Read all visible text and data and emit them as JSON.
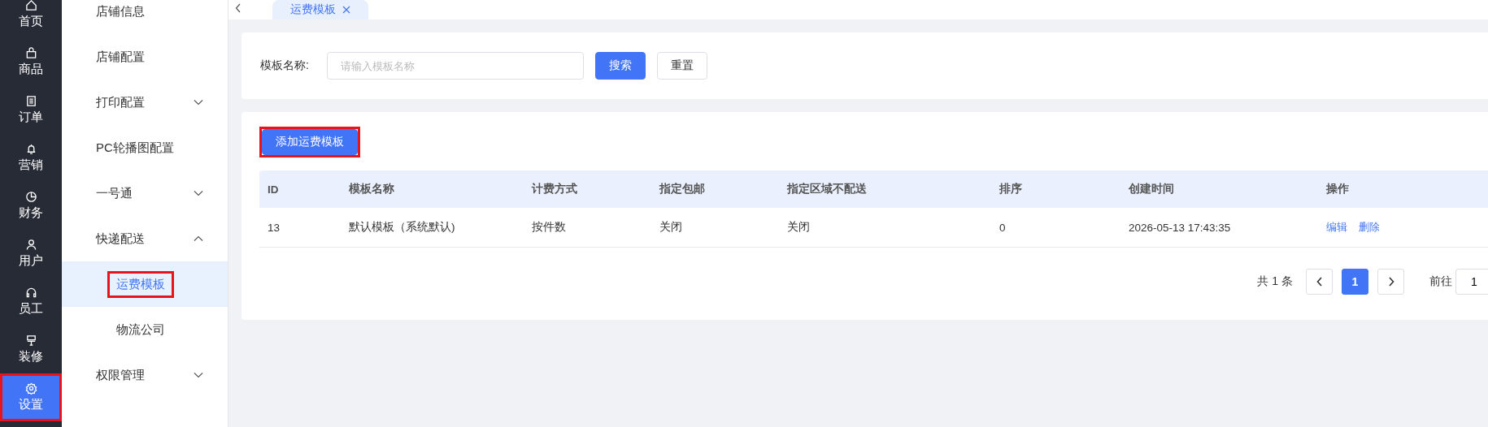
{
  "rail": [
    {
      "label": "首页",
      "selected": false,
      "highlighted": false
    },
    {
      "label": "商品",
      "selected": false,
      "highlighted": false
    },
    {
      "label": "订单",
      "selected": false,
      "highlighted": false
    },
    {
      "label": "营销",
      "selected": false,
      "highlighted": false
    },
    {
      "label": "财务",
      "selected": false,
      "highlighted": false
    },
    {
      "label": "用户",
      "selected": false,
      "highlighted": false
    },
    {
      "label": "员工",
      "selected": false,
      "highlighted": false
    },
    {
      "label": "装修",
      "selected": false,
      "highlighted": false
    },
    {
      "label": "设置",
      "selected": true,
      "highlighted": true
    }
  ],
  "submenu": [
    {
      "label": "店铺信息",
      "kind": "item"
    },
    {
      "label": "店铺配置",
      "kind": "item"
    },
    {
      "label": "打印配置",
      "kind": "group",
      "expanded": false
    },
    {
      "label": "PC轮播图配置",
      "kind": "item"
    },
    {
      "label": "一号通",
      "kind": "group",
      "expanded": false
    },
    {
      "label": "快递配送",
      "kind": "group",
      "expanded": true,
      "children": [
        {
          "label": "运费模板",
          "selected": true,
          "highlighted": true
        },
        {
          "label": "物流公司",
          "selected": false,
          "highlighted": false
        }
      ]
    },
    {
      "label": "权限管理",
      "kind": "group",
      "expanded": false
    }
  ],
  "tabs": [
    {
      "label": "运费模板",
      "selected": true
    }
  ],
  "search": {
    "label": "模板名称:",
    "placeholder": "请输入模板名称",
    "buttons": [
      {
        "label": "搜索",
        "kind": "primary"
      },
      {
        "label": "重置",
        "kind": "default"
      }
    ]
  },
  "add_button": {
    "label": "添加运费模板",
    "highlighted": true
  },
  "table": {
    "columns": [
      "ID",
      "模板名称",
      "计费方式",
      "指定包邮",
      "指定区域不配送",
      "排序",
      "创建时间",
      "操作"
    ],
    "rows": [
      {
        "cells": [
          "13",
          "默认模板（系统默认)",
          "按件数",
          "关闭",
          "关闭",
          "0",
          "2026-05-13 17:43:35"
        ],
        "actions": [
          "编辑",
          "删除"
        ]
      }
    ]
  },
  "pagination": {
    "total": "共 1 条",
    "pages": [
      {
        "label": "1",
        "selected": true
      }
    ],
    "goto_label": "前往",
    "goto_value": "1"
  }
}
